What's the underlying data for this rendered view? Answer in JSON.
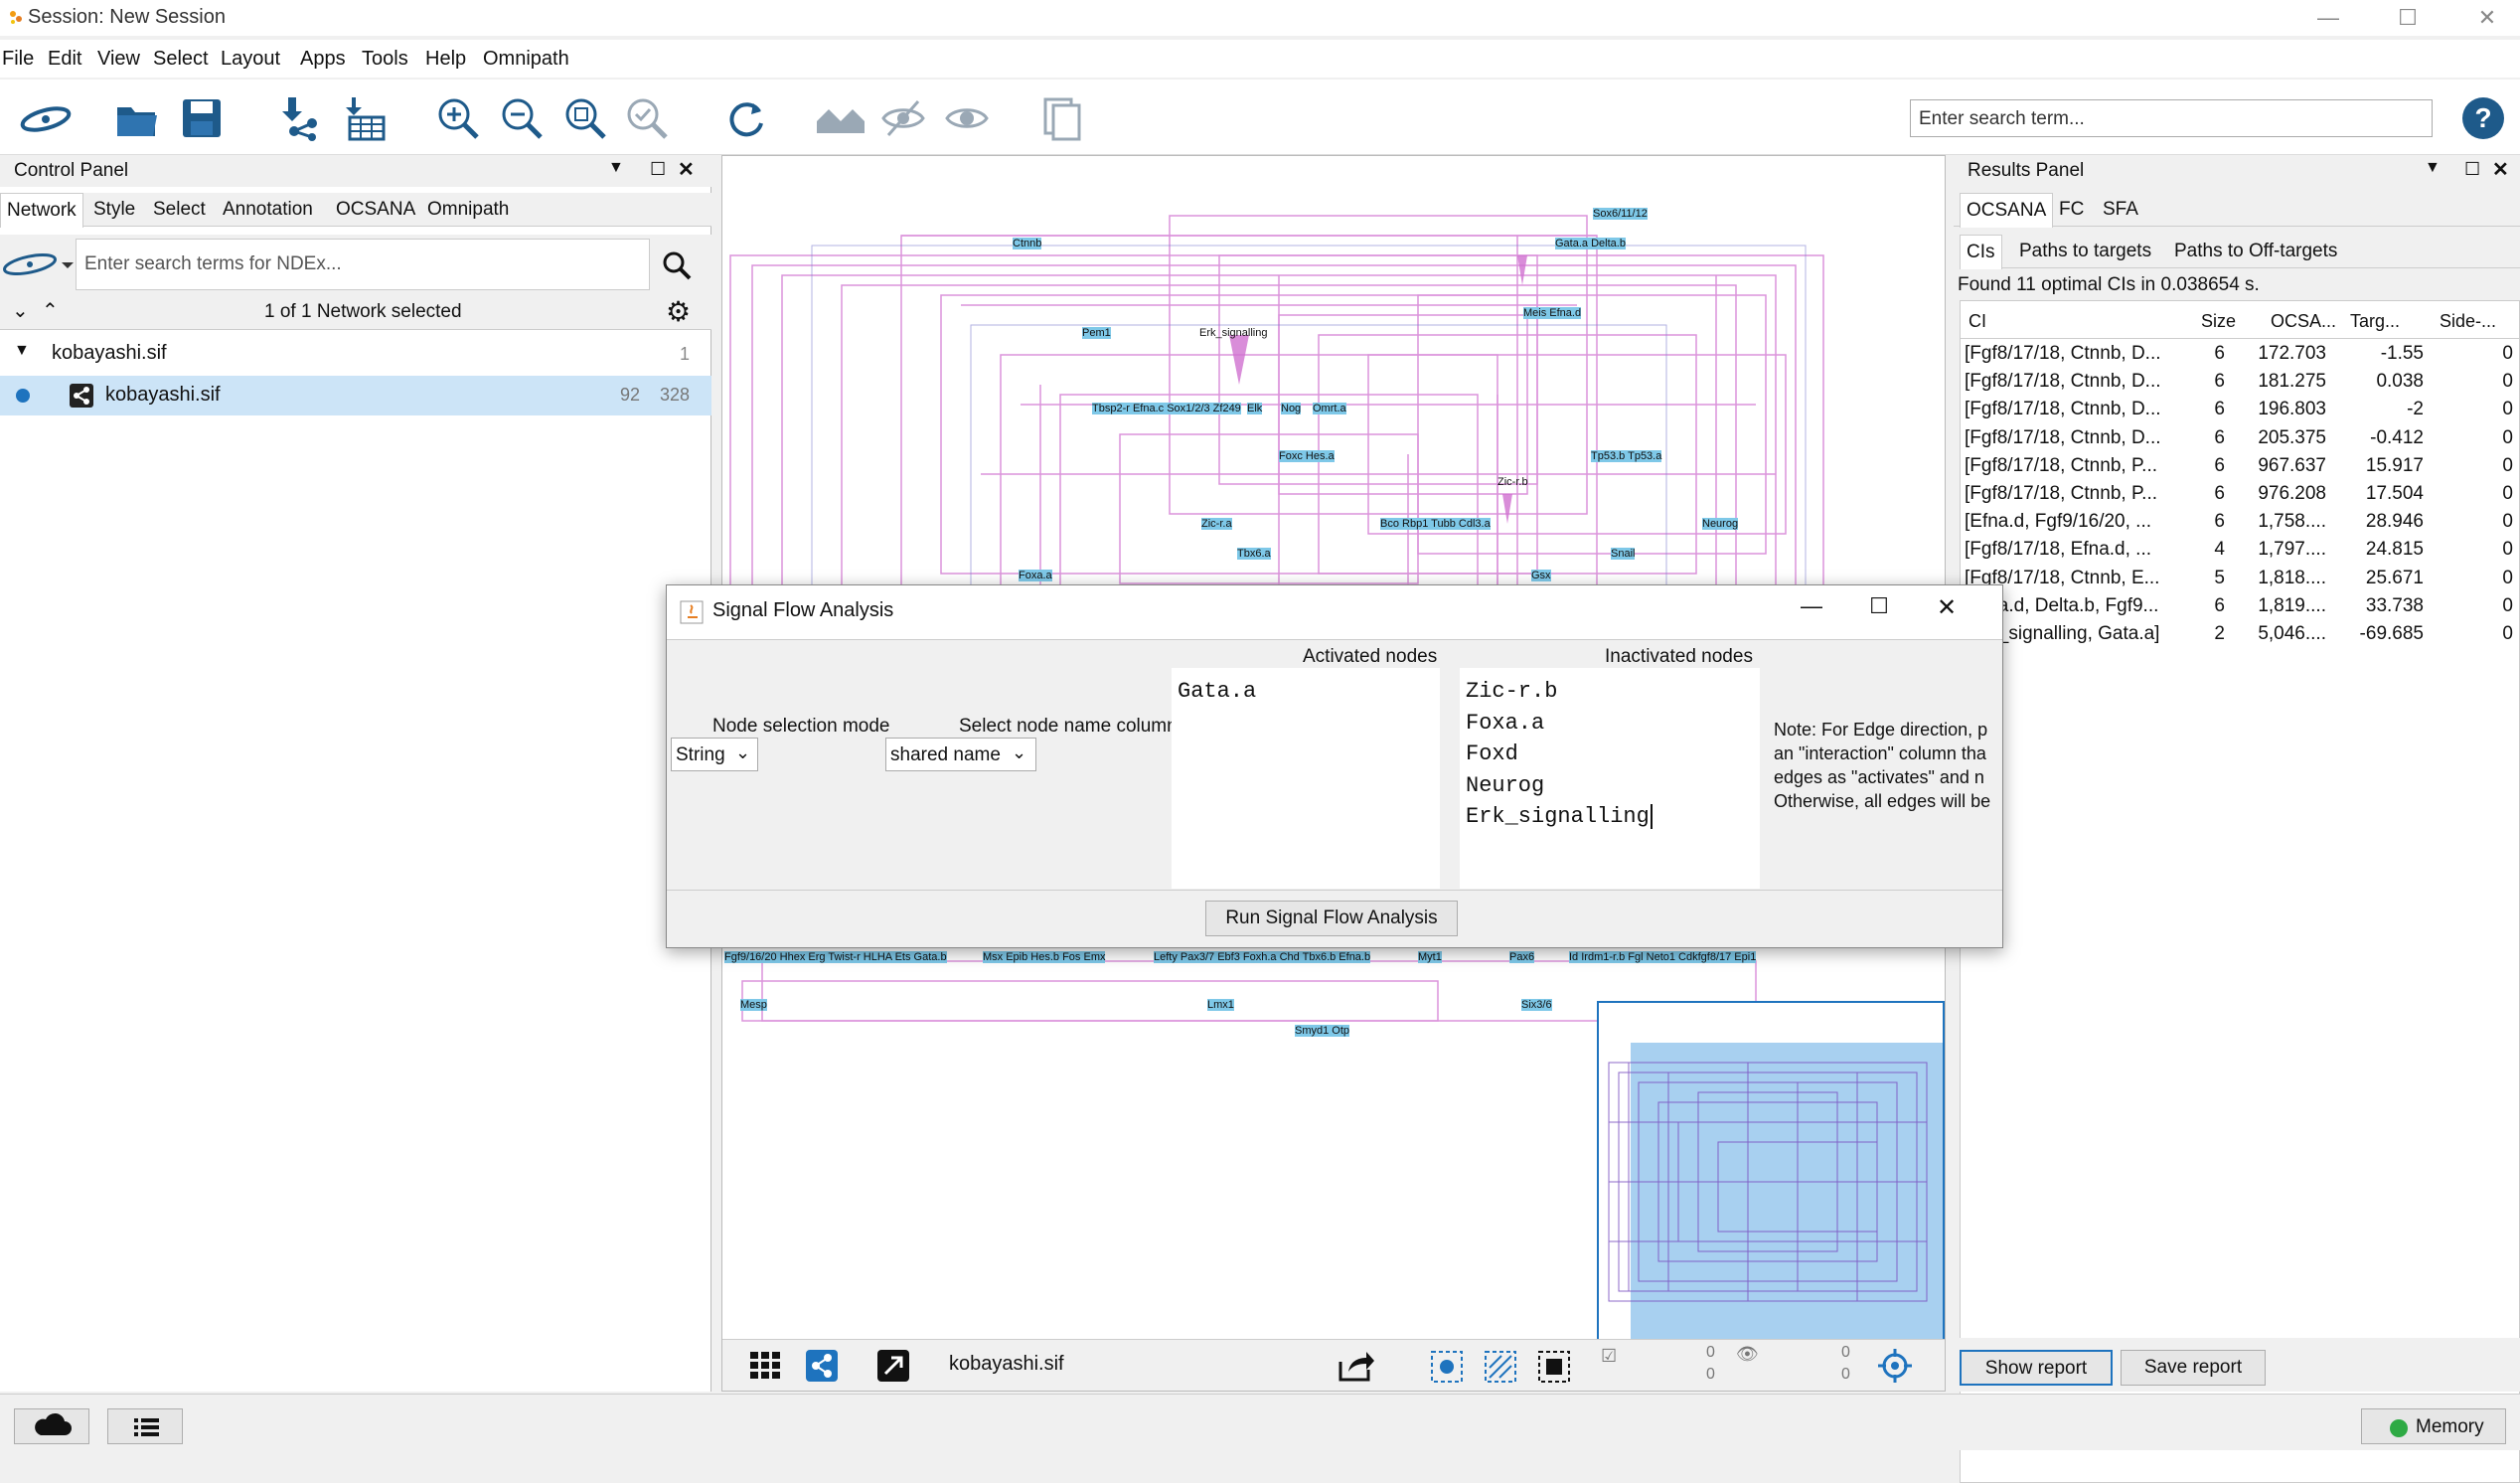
{
  "window": {
    "title": "Session: New Session"
  },
  "menu": [
    "File",
    "Edit",
    "View",
    "Select",
    "Layout",
    "Apps",
    "Tools",
    "Help",
    "Omnipath"
  ],
  "toolbar": {
    "search_placeholder": "Enter search term..."
  },
  "control_panel": {
    "title": "Control Panel",
    "tabs": [
      "Network",
      "Style",
      "Select",
      "Annotation",
      "OCSANA",
      "Omnipath"
    ],
    "ndex_placeholder": "Enter search terms for NDEx...",
    "selection_status": "1 of 1 Network selected",
    "collection": {
      "name": "kobayashi.sif",
      "count": "1"
    },
    "network": {
      "name": "kobayashi.sif",
      "nodes": "92",
      "edges": "328"
    }
  },
  "network_view": {
    "node_labels": [
      {
        "text": "Ctnnb"
      },
      {
        "text": "Sox6/11/12"
      },
      {
        "text": "Gata.a Delta.b"
      },
      {
        "text": "Meis Efna.d"
      },
      {
        "text": "Pem1"
      },
      {
        "text": "Erk_signalling"
      },
      {
        "text": "Tbsp2-r Efna.c Sox1/2/3 Zf249"
      },
      {
        "text": "Elk"
      },
      {
        "text": "Nog"
      },
      {
        "text": "Omrt.a"
      },
      {
        "text": "Foxc Hes.a"
      },
      {
        "text": "Tp53.b Tp53.a"
      },
      {
        "text": "Zic-r.b"
      },
      {
        "text": "Zic-r.a"
      },
      {
        "text": "Bco Rbp1 Tubb Cdl3.a"
      },
      {
        "text": "Neurog"
      },
      {
        "text": "Tbx6.a"
      },
      {
        "text": "Snail"
      },
      {
        "text": "Foxa.a"
      },
      {
        "text": "Gsx"
      },
      {
        "text": "Fgf9/16/20 Hhex Erg Twist-r HLHA Ets Gata.b"
      },
      {
        "text": "Msx Epib Hes.b Fos Emx"
      },
      {
        "text": "Lefty Pax3/7 Ebf3 Foxh.a Chd Tbx6.b Efna.b"
      },
      {
        "text": "Myt1"
      },
      {
        "text": "Pax6"
      },
      {
        "text": "Id Irdm1-r.b Fgl Neto1 Cdkfgf8/17 Epi1"
      },
      {
        "text": "Mesp"
      },
      {
        "text": "Lmx1"
      },
      {
        "text": "Six3/6"
      },
      {
        "text": "Smyd1 Otp"
      }
    ],
    "footer_network": "kobayashi.sif",
    "footer_counts": {
      "a": "0",
      "b": "0",
      "c": "0",
      "d": "0"
    }
  },
  "results_panel": {
    "title": "Results Panel",
    "tabs": [
      "OCSANA",
      "FC",
      "SFA"
    ],
    "subtabs": [
      "CIs",
      "Paths to targets",
      "Paths to Off-targets"
    ],
    "status": "Found 11 optimal CIs in 0.038654 s.",
    "columns": [
      "CI",
      "Size",
      "OCSA...",
      "Targ...",
      "Side-..."
    ],
    "rows": [
      [
        "[Fgf8/17/18, Ctnnb, D...",
        "6",
        "172.703",
        "-1.55",
        "0"
      ],
      [
        "[Fgf8/17/18, Ctnnb, D...",
        "6",
        "181.275",
        "0.038",
        "0"
      ],
      [
        "[Fgf8/17/18, Ctnnb, D...",
        "6",
        "196.803",
        "-2",
        "0"
      ],
      [
        "[Fgf8/17/18, Ctnnb, D...",
        "6",
        "205.375",
        "-0.412",
        "0"
      ],
      [
        "[Fgf8/17/18, Ctnnb, P...",
        "6",
        "967.637",
        "15.917",
        "0"
      ],
      [
        "[Fgf8/17/18, Ctnnb, P...",
        "6",
        "976.208",
        "17.504",
        "0"
      ],
      [
        "[Efna.d, Fgf9/16/20, ...",
        "6",
        "1,758....",
        "28.946",
        "0"
      ],
      [
        "[Fgf8/17/18, Efna.d, ...",
        "4",
        "1,797....",
        "24.815",
        "0"
      ],
      [
        "[Fgf8/17/18, Ctnnb, E...",
        "5",
        "1,818....",
        "25.671",
        "0"
      ],
      [
        "[Efna.d, Delta.b, Fgf9...",
        "6",
        "1,819....",
        "33.738",
        "0"
      ],
      [
        "[Erk_signalling, Gata.a]",
        "2",
        "5,046....",
        "-69.685",
        "0"
      ]
    ],
    "show_report": "Show report",
    "save_report": "Save report"
  },
  "dialog": {
    "title": "Signal Flow Analysis",
    "activated_header": "Activated nodes",
    "inactivated_header": "Inactivated nodes",
    "node_selection_label": "Node selection mode",
    "node_selection_value": "String",
    "name_column_label": "Select node name column",
    "name_column_value": "shared name",
    "activated_nodes": [
      "Gata.a"
    ],
    "inactivated_nodes": [
      "Zic-r.b",
      "Foxa.a",
      "Foxd",
      "Neurog",
      "Erk_signalling"
    ],
    "note_lines": [
      "Note: For Edge direction, p",
      "an \"interaction\" column tha",
      "edges as \"activates\" and n",
      "Otherwise, all edges will be"
    ],
    "run_button": "Run Signal Flow Analysis"
  },
  "statusbar": {
    "memory": "Memory"
  },
  "colors": {
    "selection": "#cce4f7",
    "accent": "#1e73be",
    "edge": "#d070d0",
    "node": "#7ec8e8",
    "memory_dot": "#2eaa44"
  }
}
